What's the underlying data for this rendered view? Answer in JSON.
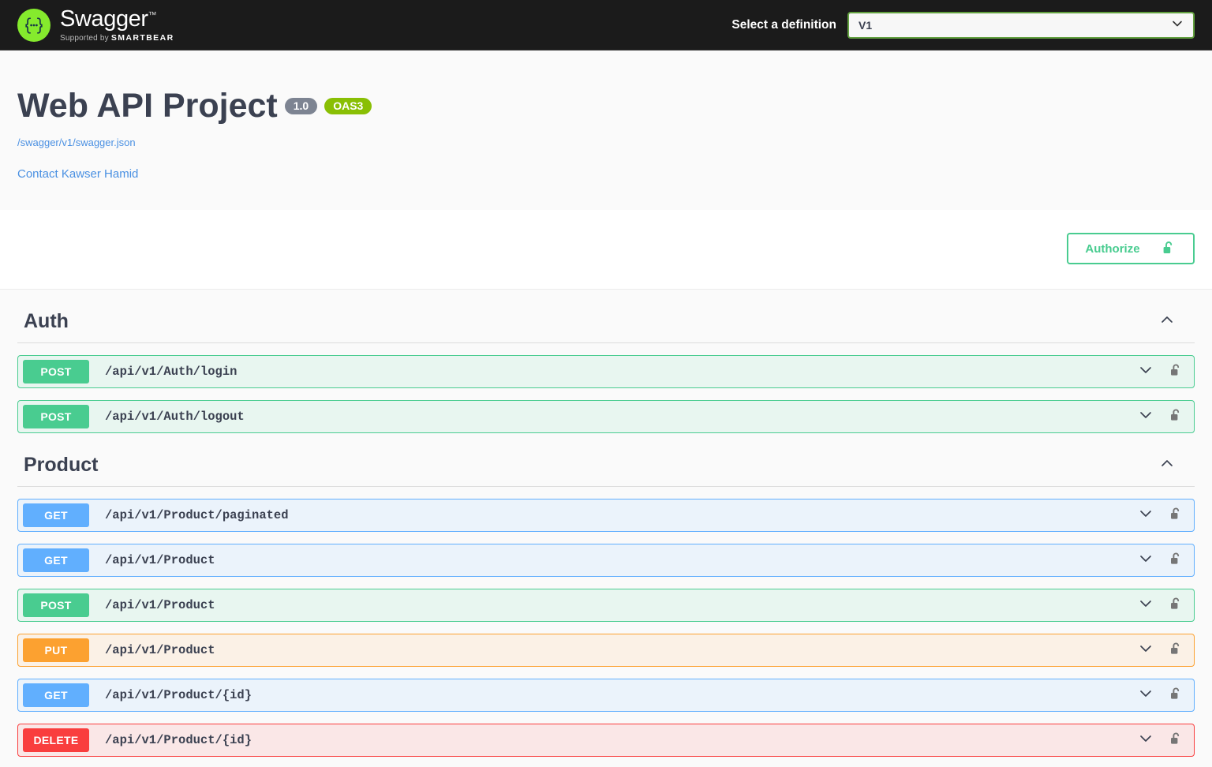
{
  "topbar": {
    "brand_name": "Swagger",
    "brand_trademark": "™",
    "brand_supported_prefix": "Supported by ",
    "brand_supported_company": "SMARTBEAR",
    "definition_label": "Select a definition",
    "definition_value": "V1",
    "logo_glyph": "{...}"
  },
  "info": {
    "title": "Web API Project",
    "version_badge": "1.0",
    "spec_badge": "OAS3",
    "spec_url": "/swagger/v1/swagger.json",
    "contact": "Contact Kawser Hamid"
  },
  "authorize": {
    "label": "Authorize",
    "icon": "unlock-icon"
  },
  "colors": {
    "get": "#61affe",
    "post": "#49cc90",
    "put": "#fca130",
    "delete": "#f93e3e",
    "brand_green": "#85ea2d",
    "oas_badge": "#89bf04",
    "version_badge": "#7d8492",
    "authorize_green": "#49cc90"
  },
  "tags": [
    {
      "name": "Auth",
      "collapse_icon": "chevron-up-icon",
      "operations": [
        {
          "method": "POST",
          "method_key": "post",
          "path": "/api/v1/Auth/login",
          "expand_icon": "chevron-down-icon",
          "lock_icon": "unlock-icon"
        },
        {
          "method": "POST",
          "method_key": "post",
          "path": "/api/v1/Auth/logout",
          "expand_icon": "chevron-down-icon",
          "lock_icon": "unlock-icon"
        }
      ]
    },
    {
      "name": "Product",
      "collapse_icon": "chevron-up-icon",
      "operations": [
        {
          "method": "GET",
          "method_key": "get",
          "path": "/api/v1/Product/paginated",
          "expand_icon": "chevron-down-icon",
          "lock_icon": "unlock-icon"
        },
        {
          "method": "GET",
          "method_key": "get",
          "path": "/api/v1/Product",
          "expand_icon": "chevron-down-icon",
          "lock_icon": "unlock-icon"
        },
        {
          "method": "POST",
          "method_key": "post",
          "path": "/api/v1/Product",
          "expand_icon": "chevron-down-icon",
          "lock_icon": "unlock-icon"
        },
        {
          "method": "PUT",
          "method_key": "put",
          "path": "/api/v1/Product",
          "expand_icon": "chevron-down-icon",
          "lock_icon": "unlock-icon"
        },
        {
          "method": "GET",
          "method_key": "get",
          "path": "/api/v1/Product/{id}",
          "expand_icon": "chevron-down-icon",
          "lock_icon": "unlock-icon"
        },
        {
          "method": "DELETE",
          "method_key": "delete",
          "path": "/api/v1/Product/{id}",
          "expand_icon": "chevron-down-icon",
          "lock_icon": "unlock-icon"
        }
      ]
    }
  ]
}
